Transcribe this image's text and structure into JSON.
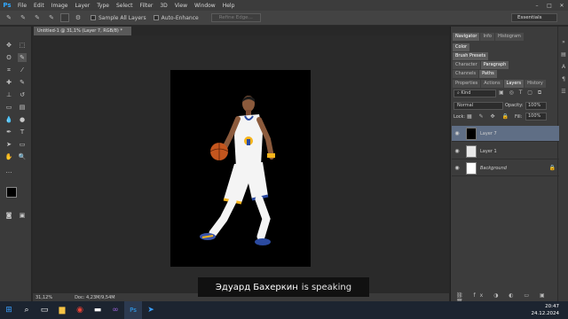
{
  "app": {
    "logo": "Ps"
  },
  "menu": [
    "File",
    "Edit",
    "Image",
    "Layer",
    "Type",
    "Select",
    "Filter",
    "3D",
    "View",
    "Window",
    "Help"
  ],
  "window_controls": [
    "–",
    "□",
    "✕"
  ],
  "options": {
    "sample_all_layers": "Sample All Layers",
    "auto_enhance": "Auto-Enhance",
    "refine_edge": "Refine Edge...",
    "workspace": "Essentials"
  },
  "document": {
    "tab_title": "Untitled-1 @ 31,1% (Layer 7, RGB/8) *"
  },
  "status": {
    "zoom": "31,12%",
    "doc_size": "Doc: 4,23M/9,54M"
  },
  "panels": {
    "row1": [
      "Navigator",
      "Info",
      "Histogram"
    ],
    "row2": [
      "Color"
    ],
    "row3": [
      "Brush Presets"
    ],
    "row4": [
      "Character",
      "Paragraph"
    ],
    "row5": [
      "Channels",
      "Paths"
    ],
    "row6": [
      "Properties",
      "Actions",
      "Layers",
      "History"
    ],
    "kind_label": "Kind",
    "blend_mode": "Normal",
    "opacity_label": "Opacity:",
    "opacity_value": "100%",
    "lock_label": "Lock:",
    "fill_label": "Fill:",
    "fill_value": "100%"
  },
  "layers": [
    {
      "name": "Layer 7",
      "selected": true
    },
    {
      "name": "Layer 1",
      "selected": false
    },
    {
      "name": "Background",
      "selected": false
    }
  ],
  "caption": {
    "speaker": "Эдуард Бахеркин",
    "suffix": "is speaking"
  },
  "taskbar": {
    "time": "20:47",
    "date": "24.12.2024"
  },
  "colors": {
    "accent": "#31a8ff",
    "selected_layer": "#5f6e85"
  }
}
